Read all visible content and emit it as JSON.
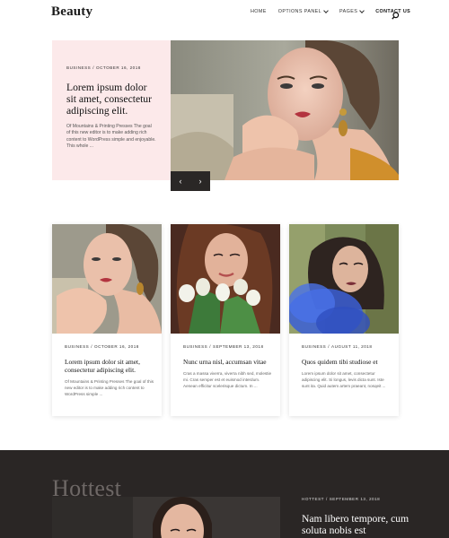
{
  "header": {
    "logo": "Beauty",
    "nav": [
      {
        "label": "HOME",
        "dropdown": false
      },
      {
        "label": "OPTIONS PANEL",
        "dropdown": true
      },
      {
        "label": "PAGES",
        "dropdown": true
      },
      {
        "label": "CONTACT US",
        "dropdown": false
      }
    ],
    "search_icon": "search-icon"
  },
  "hero": {
    "category": "BUSINESS",
    "separator": "/",
    "date": "OCTOBER 16, 2018",
    "title": "Lorem ipsum dolor sit amet, consectetur adipiscing elit.",
    "excerpt": "Of Mountains & Printing Presses The goal of this new editor is to make adding rich content to WordPress simple and enjoyable. This whole ...",
    "prev_icon": "chevron-left-icon",
    "next_icon": "chevron-right-icon",
    "prev_glyph": "‹",
    "next_glyph": "›"
  },
  "cards": [
    {
      "category": "BUSINESS",
      "separator": "/",
      "date": "OCTOBER 16, 2018",
      "title": "Lorem ipsum dolor sit amet, consectetur adipiscing elit.",
      "excerpt": "Of Mountains & Printing Presses The goal of this new editor is to make adding rich content to WordPress simple ..."
    },
    {
      "category": "BUSINESS",
      "separator": "/",
      "date": "SEPTEMBER 13, 2018",
      "title": "Nunc urna nisl, accumsan vitae",
      "excerpt": "Cras a massa viverra, viverra nibh sed, molestie mi. Cras semper est et euismod interdum. Aenean efficitur scelerisque dictum. In ..."
    },
    {
      "category": "BUSINESS",
      "separator": "/",
      "date": "AUGUST 11, 2018",
      "title": "Quos quidem tibi studiose et",
      "excerpt": "Lorem ipsum dolor sit amet, consectetur adipiscing elit. Si longus, levis dicta sunt. Iste sunt ita. Quid autem artem praeant, nosqeit ..."
    }
  ],
  "hottest": {
    "heading": "Hottest",
    "category": "HOTTEST",
    "separator": "/",
    "date": "SEPTEMBER 13, 2018",
    "title": "Nam libero tempore, cum soluta nobis est"
  },
  "colors": {
    "accent_pink": "#fce9ea",
    "dark_bg": "#2a2625",
    "slider_bg": "#2a2726"
  }
}
